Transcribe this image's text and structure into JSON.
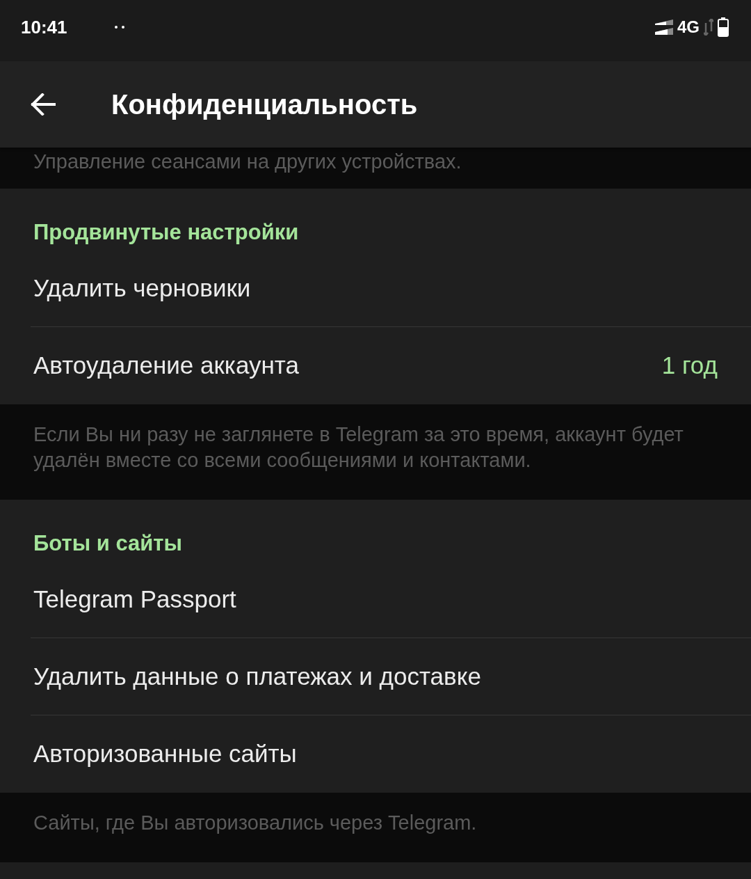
{
  "status_bar": {
    "time": "10:41",
    "network": "4G"
  },
  "header": {
    "title": "Конфиденциальность"
  },
  "sections": [
    {
      "kind": "hint",
      "text": "Управление сеансами на других устройствах."
    },
    {
      "kind": "group",
      "title": "Продвинутые настройки",
      "rows": [
        {
          "label": "Удалить черновики"
        },
        {
          "label": "Автоудаление аккаунта",
          "value": "1 год"
        }
      ]
    },
    {
      "kind": "hint",
      "text": "Если Вы ни разу не заглянете в Telegram за это время, аккаунт будет удалён вместе со всеми сообщениями и контактами."
    },
    {
      "kind": "group",
      "title": "Боты и сайты",
      "rows": [
        {
          "label": "Telegram Passport"
        },
        {
          "label": "Удалить данные о платежах и доставке"
        },
        {
          "label": "Авторизованные сайты"
        }
      ]
    },
    {
      "kind": "hint",
      "text": "Сайты, где Вы авторизовались через Telegram."
    }
  ]
}
